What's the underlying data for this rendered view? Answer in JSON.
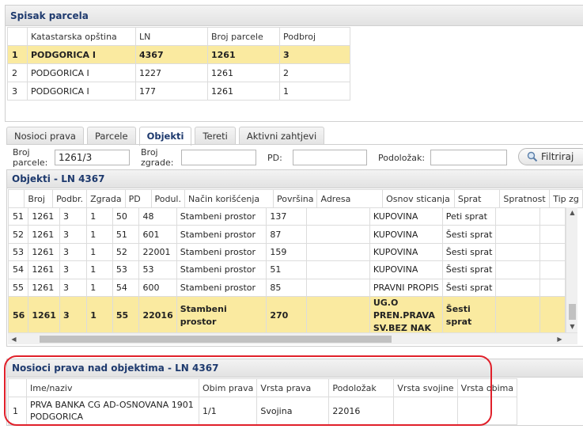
{
  "parcels": {
    "title": "Spisak parcela",
    "columns": [
      "Katastarska opština",
      "LN",
      "Broj parcele",
      "Podbroj"
    ],
    "rows": [
      {
        "n": "1",
        "ko": "PODGORICA I",
        "ln": "4367",
        "broj": "1261",
        "podbroj": "3",
        "selected": true
      },
      {
        "n": "2",
        "ko": "PODGORICA I",
        "ln": "1227",
        "broj": "1261",
        "podbroj": "2"
      },
      {
        "n": "3",
        "ko": "PODGORICA I",
        "ln": "177",
        "broj": "1261",
        "podbroj": "1"
      }
    ]
  },
  "tabs": [
    {
      "label": "Nosioci prava"
    },
    {
      "label": "Parcele"
    },
    {
      "label": "Objekti",
      "active": true
    },
    {
      "label": "Tereti"
    },
    {
      "label": "Aktivni zahtjevi"
    }
  ],
  "filter": {
    "broj_parcele_label": "Broj\nparcele:",
    "broj_parcele_value": "1261/3",
    "broj_zgrade_label": "Broj\nzgrade:",
    "broj_zgrade_value": "",
    "pd_label": "PD:",
    "pd_value": "",
    "podulozak_label": "Podoložak:",
    "podulozak_value": "",
    "button_label": "Filtriraj"
  },
  "objekti": {
    "title": "Objekti - LN 4367",
    "columns": [
      "",
      "Broj",
      "Podbr.",
      "Zgrada",
      "PD",
      "Podul.",
      "Način korišćenja",
      "Površina",
      "Adresa",
      "Osnov sticanja",
      "Sprat",
      "Spratnost",
      "Tip zg"
    ],
    "rows": [
      {
        "n": "51",
        "broj": "1261",
        "podbr": "3",
        "zgrada": "1",
        "pd": "50",
        "podul": "48",
        "nacin": "Stambeni prostor",
        "povrsina": "137",
        "adresa": "",
        "osnov": "KUPOVINA",
        "sprat": "Peti sprat",
        "spratnost": "",
        "tip": ""
      },
      {
        "n": "52",
        "broj": "1261",
        "podbr": "3",
        "zgrada": "1",
        "pd": "51",
        "podul": "601",
        "nacin": "Stambeni prostor",
        "povrsina": "87",
        "adresa": "",
        "osnov": "KUPOVINA",
        "sprat": "Šesti sprat",
        "spratnost": "",
        "tip": ""
      },
      {
        "n": "53",
        "broj": "1261",
        "podbr": "3",
        "zgrada": "1",
        "pd": "52",
        "podul": "22001",
        "nacin": "Stambeni prostor",
        "povrsina": "159",
        "adresa": "",
        "osnov": "KUPOVINA",
        "sprat": "Šesti sprat",
        "spratnost": "",
        "tip": ""
      },
      {
        "n": "54",
        "broj": "1261",
        "podbr": "3",
        "zgrada": "1",
        "pd": "53",
        "podul": "53",
        "nacin": "Stambeni prostor",
        "povrsina": "51",
        "adresa": "",
        "osnov": "KUPOVINA",
        "sprat": "Šesti sprat",
        "spratnost": "",
        "tip": ""
      },
      {
        "n": "55",
        "broj": "1261",
        "podbr": "3",
        "zgrada": "1",
        "pd": "54",
        "podul": "600",
        "nacin": "Stambeni prostor",
        "povrsina": "85",
        "adresa": "",
        "osnov": "PRAVNI PROPIS",
        "sprat": "Šesti sprat",
        "spratnost": "",
        "tip": ""
      },
      {
        "n": "56",
        "broj": "1261",
        "podbr": "3",
        "zgrada": "1",
        "pd": "55",
        "podul": "22016",
        "nacin": "Stambeni prostor",
        "povrsina": "270",
        "adresa": "",
        "osnov": "UG.O PREN.PRAVA SV.BEZ NAK",
        "sprat": "Šesti sprat",
        "spratnost": "",
        "tip": "",
        "selected": true
      }
    ]
  },
  "nosioci": {
    "title": "Nosioci prava nad objektima - LN 4367",
    "columns": [
      "",
      "Ime/naziv",
      "Obim prava",
      "Vrsta prava",
      "Podoložak",
      "Vrsta svojine",
      "Vrsta obima"
    ],
    "rows": [
      {
        "n": "1",
        "ime": "PRVA BANKA CG AD-OSNOVANA 1901 PODGORICA",
        "obim": "1/1",
        "vrsta": "Svojina",
        "podulozak": "22016",
        "vrsta_svojine": "",
        "vrsta_obima": ""
      }
    ]
  },
  "colors": {
    "selected_row": "#faeaa0",
    "header_text": "#1e3a6e",
    "highlight_ring": "#e0202a"
  }
}
